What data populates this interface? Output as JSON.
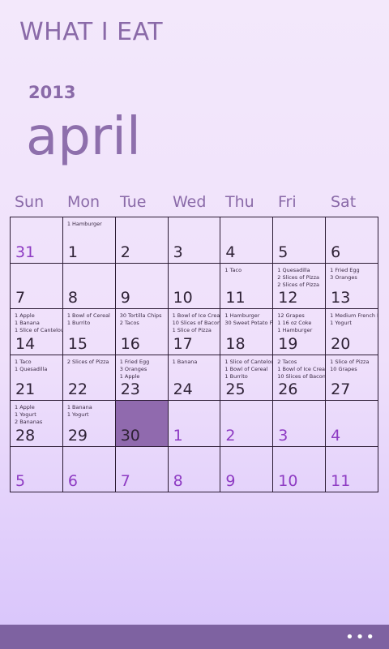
{
  "app_title": "WHAT I EAT",
  "year": "2013",
  "month": "april",
  "weekdays": [
    "Sun",
    "Mon",
    "Tue",
    "Wed",
    "Thu",
    "Fri",
    "Sat"
  ],
  "weeks": [
    [
      {
        "day": "31",
        "other": true,
        "entries": []
      },
      {
        "day": "1",
        "entries": [
          "1 Hamburger"
        ]
      },
      {
        "day": "2",
        "entries": []
      },
      {
        "day": "3",
        "entries": []
      },
      {
        "day": "4",
        "entries": []
      },
      {
        "day": "5",
        "entries": []
      },
      {
        "day": "6",
        "entries": []
      }
    ],
    [
      {
        "day": "7",
        "entries": []
      },
      {
        "day": "8",
        "entries": []
      },
      {
        "day": "9",
        "entries": []
      },
      {
        "day": "10",
        "entries": []
      },
      {
        "day": "11",
        "entries": [
          "1 Taco"
        ]
      },
      {
        "day": "12",
        "entries": [
          "1 Quesadilla",
          "2 Slices of Pizza",
          "2 Slices of Pizza"
        ]
      },
      {
        "day": "13",
        "entries": [
          "1 Fried Egg",
          "3 Oranges"
        ]
      }
    ],
    [
      {
        "day": "14",
        "entries": [
          "1 Apple",
          "1 Banana",
          "1 Slice of Cantelou"
        ]
      },
      {
        "day": "15",
        "entries": [
          "1 Bowl of Cereal",
          "1 Burrito"
        ]
      },
      {
        "day": "16",
        "entries": [
          "30 Tortilla Chips",
          "2 Tacos"
        ]
      },
      {
        "day": "17",
        "entries": [
          "1 Bowl of Ice Crea",
          "10 Slices of Bacon",
          "1 Slice of Pizza"
        ]
      },
      {
        "day": "18",
        "entries": [
          "1 Hamburger",
          "30 Sweet Potato F"
        ]
      },
      {
        "day": "19",
        "entries": [
          "12 Grapes",
          "1 16 oz Coke",
          "1 Hamburger"
        ]
      },
      {
        "day": "20",
        "entries": [
          "1 Medium French I",
          "1 Yogurt"
        ]
      }
    ],
    [
      {
        "day": "21",
        "entries": [
          "1 Taco",
          "1 Quesadilla"
        ]
      },
      {
        "day": "22",
        "entries": [
          "2 Slices of Pizza"
        ]
      },
      {
        "day": "23",
        "entries": [
          "1 Fried Egg",
          "3 Oranges",
          "1 Apple"
        ]
      },
      {
        "day": "24",
        "entries": [
          "1 Banana"
        ]
      },
      {
        "day": "25",
        "entries": [
          "1 Slice of Cantelou",
          "1 Bowl of Cereal",
          "1 Burrito"
        ]
      },
      {
        "day": "26",
        "entries": [
          "2 Tacos",
          "1 Bowl of Ice Crear",
          "10 Slices of Bacon"
        ]
      },
      {
        "day": "27",
        "entries": [
          "1 Slice of Pizza",
          "10 Grapes"
        ]
      }
    ],
    [
      {
        "day": "28",
        "entries": [
          "1 Apple",
          "1 Yogurt",
          "2 Bananas"
        ]
      },
      {
        "day": "29",
        "entries": [
          "1 Banana",
          "1 Yogurt"
        ]
      },
      {
        "day": "30",
        "today": true,
        "entries": []
      },
      {
        "day": "1",
        "other": true,
        "entries": []
      },
      {
        "day": "2",
        "other": true,
        "entries": []
      },
      {
        "day": "3",
        "other": true,
        "entries": []
      },
      {
        "day": "4",
        "other": true,
        "entries": []
      }
    ],
    [
      {
        "day": "5",
        "other": true,
        "entries": []
      },
      {
        "day": "6",
        "other": true,
        "entries": []
      },
      {
        "day": "7",
        "other": true,
        "entries": []
      },
      {
        "day": "8",
        "other": true,
        "entries": []
      },
      {
        "day": "9",
        "other": true,
        "entries": []
      },
      {
        "day": "10",
        "other": true,
        "entries": []
      },
      {
        "day": "11",
        "other": true,
        "entries": []
      }
    ]
  ],
  "appbar": {
    "more_label": "•••",
    "more_icon": "ellipsis-icon"
  },
  "colors": {
    "accent": "#7e62a1",
    "today": "#906aae",
    "other_month_text": "#8e3bc3"
  }
}
